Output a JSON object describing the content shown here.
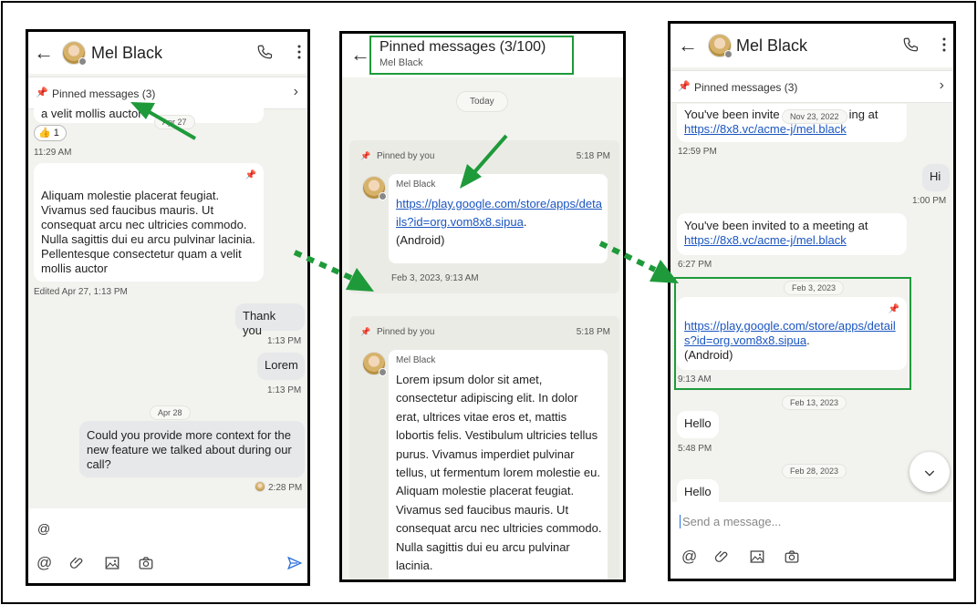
{
  "left": {
    "contact": "Mel Black",
    "pinned_bar": "Pinned messages (3)",
    "msg_top_fragment": "a velit mollis auctor",
    "date_overlay": "Apr 27",
    "reaction": "👍",
    "reaction_count": "1",
    "time_1": "11:29 AM",
    "long_message": "Aliquam molestie placerat feugiat. Vivamus sed faucibus mauris. Ut consequat arcu nec ultricies commodo. Nulla sagittis dui eu arcu pulvinar lacinia. Pellentesque consectetur quam a velit mollis auctor",
    "edited": "Edited Apr 27, 1:13 PM",
    "thank_you": "Thank you",
    "time_2": "1:13 PM",
    "lorem": "Lorem",
    "time_3": "1:13 PM",
    "date_apr28": "Apr 28",
    "question": "Could you provide more context for the new feature we talked about during our call?",
    "time_4": "2:28 PM",
    "composer_text": "@"
  },
  "middle": {
    "title": "Pinned messages (3/100)",
    "subtitle": "Mel Black",
    "today": "Today",
    "card1": {
      "pinned_by": "Pinned by you",
      "time": "5:18 PM",
      "sender": "Mel Black",
      "link": "https://play.google.com/store/apps/details?id=org.vom8x8.sipua",
      "suffix": ".",
      "android": "(Android)",
      "date": "Feb 3, 2023, 9:13 AM"
    },
    "card2": {
      "pinned_by": "Pinned by you",
      "time": "5:18 PM",
      "sender": "Mel Black",
      "text": "Lorem ipsum dolor sit amet, consectetur adipiscing elit. In dolor erat, ultrices vitae eros et, mattis lobortis felis. Vestibulum ultricies tellus purus. Vivamus imperdiet pulvinar tellus, ut fermentum lorem molestie eu. Aliquam molestie placerat feugiat. Vivamus sed faucibus mauris. Ut consequat arcu nec ultricies commodo. Nulla sagittis dui eu arcu pulvinar lacinia."
    }
  },
  "right": {
    "contact": "Mel Black",
    "pinned_bar": "Pinned messages (3)",
    "invite_fragment": "You've been invite",
    "invite_fragment2": "ing at",
    "date_nov": "Nov 23, 2022",
    "invite_link": "https://8x8.vc/acme-j/mel.black",
    "time_1": "12:59 PM",
    "hi": "Hi",
    "time_2": "1:00 PM",
    "invite_full": "You've been invited to a meeting at",
    "invite_link2": "https://8x8.vc/acme-j/mel.black",
    "time_3": "6:27 PM",
    "date_feb3": "Feb 3, 2023",
    "play_link": "https://play.google.com/store/apps/details?id=org.vom8x8.sipua",
    "play_suffix": ".",
    "android": "(Android)",
    "time_4": "9:13 AM",
    "date_feb13": "Feb 13, 2023",
    "hello1": "Hello",
    "time_5": "5:48 PM",
    "date_feb28": "Feb 28, 2023",
    "hello2": "Hello",
    "placeholder": "Send a message..."
  },
  "colors": {
    "arrow": "#1e9a3a",
    "link": "#1a55c0"
  }
}
